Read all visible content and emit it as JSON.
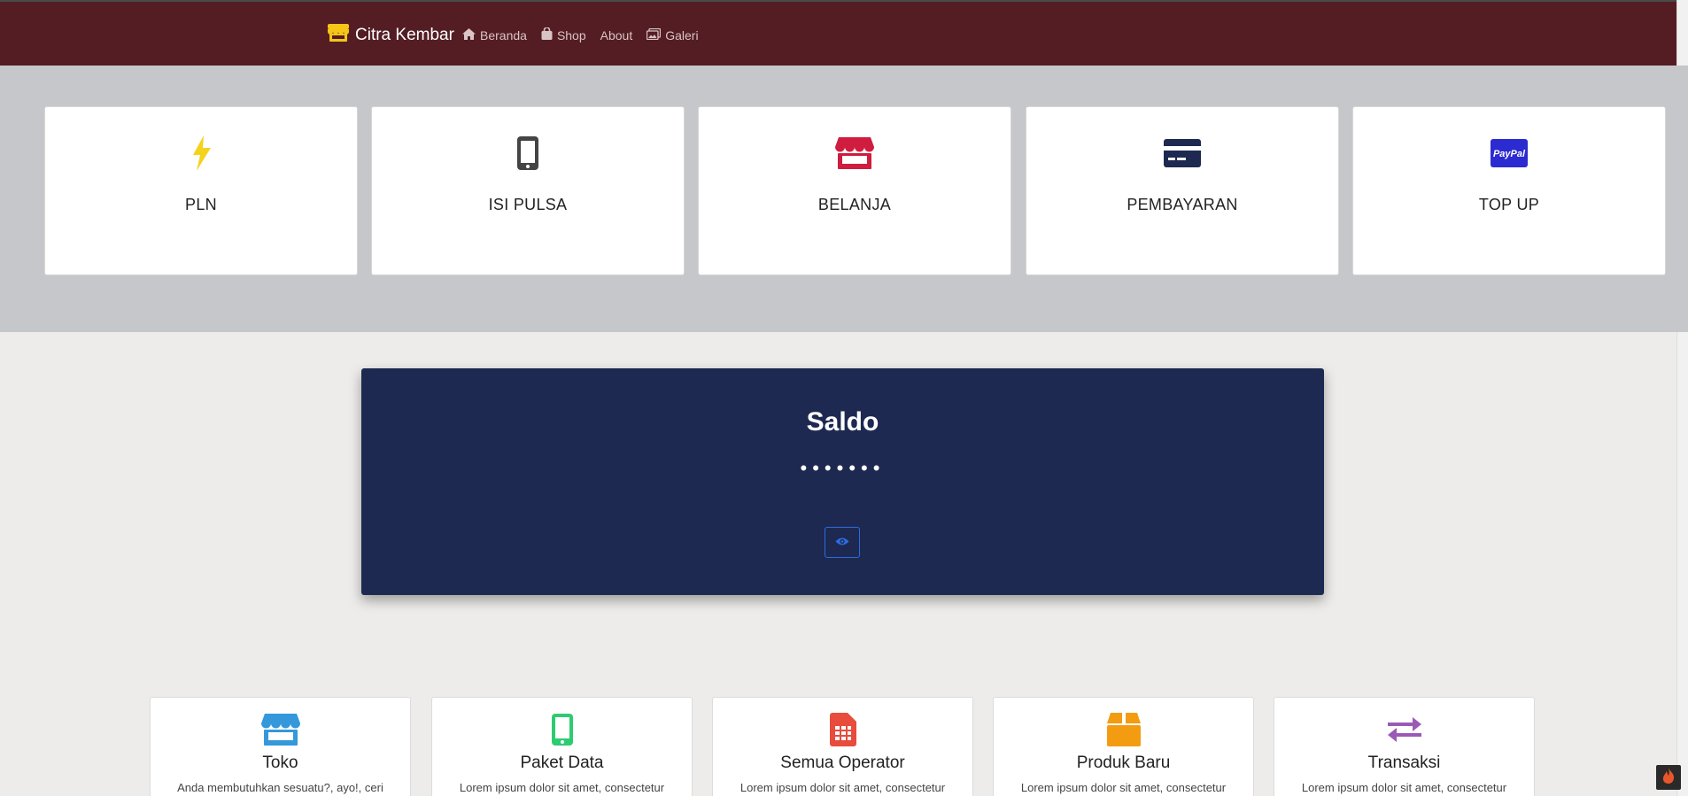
{
  "navbar": {
    "brand": "Citra Kembar",
    "links": [
      {
        "label": "Beranda",
        "icon": "home-icon"
      },
      {
        "label": "Shop",
        "icon": "bag-icon"
      },
      {
        "label": "About",
        "icon": ""
      },
      {
        "label": "Galeri",
        "icon": "gallery-icon"
      }
    ]
  },
  "services": [
    {
      "label": "PLN",
      "icon": "bolt-icon",
      "color": "#f5d21c"
    },
    {
      "label": "ISI PULSA",
      "icon": "mobile-icon",
      "color": "#444444"
    },
    {
      "label": "BELANJA",
      "icon": "store-icon",
      "color": "#d01c3f"
    },
    {
      "label": "PEMBAYARAN",
      "icon": "credit-card-icon",
      "color": "#1d2951"
    },
    {
      "label": "TOP UP",
      "icon": "paypal-icon",
      "color": "#2b2bd1"
    }
  ],
  "saldo": {
    "title": "Saldo",
    "value": "•••••••"
  },
  "features": [
    {
      "title": "Toko",
      "desc": "Anda membutuhkan sesuatu?, ayo!, ceri",
      "icon": "store-icon",
      "color": "#3498db"
    },
    {
      "title": "Paket Data",
      "desc": "Lorem ipsum dolor sit amet, consectetur",
      "icon": "mobile-icon",
      "color": "#2ecc71"
    },
    {
      "title": "Semua Operator",
      "desc": "Lorem ipsum dolor sit amet, consectetur",
      "icon": "sim-card-icon",
      "color": "#e74c3c"
    },
    {
      "title": "Produk Baru",
      "desc": "Lorem ipsum dolor sit amet, consectetur",
      "icon": "box-icon",
      "color": "#f39c12"
    },
    {
      "title": "Transaksi",
      "desc": "Lorem ipsum dolor sit amet, consectetur",
      "icon": "exchange-icon",
      "color": "#9b59b6"
    }
  ],
  "colors": {
    "navbar_bg": "#541d24",
    "band_bg": "#c6c7cb",
    "saldo_bg": "#1d2951",
    "page_bg": "#edecea",
    "brand_icon": "#f5c518"
  }
}
